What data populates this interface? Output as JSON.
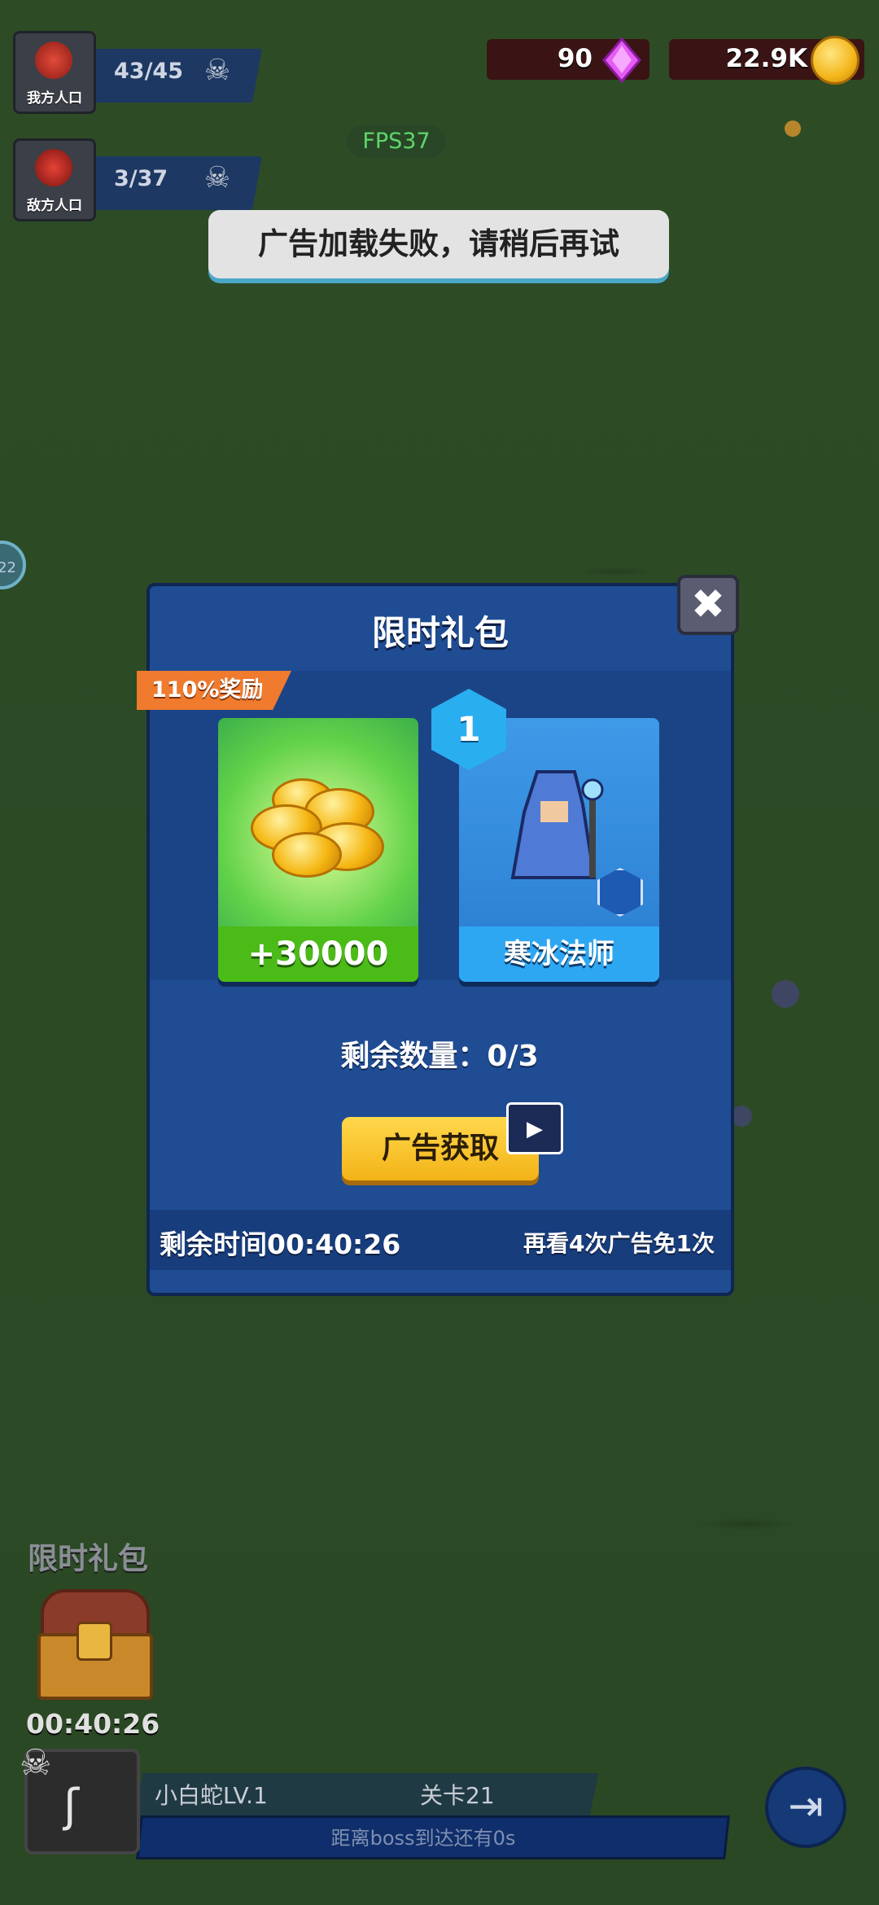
{
  "hud": {
    "ally_pop": {
      "label": "我方人口",
      "count": "43/45"
    },
    "enemy_pop": {
      "label": "敌方人口",
      "count": "3/37"
    },
    "gems": "90",
    "gold": "22.9K",
    "fps": "FPS37",
    "side_badge": "22"
  },
  "toast": "广告加载失败，请稍后再试",
  "modal": {
    "title": "限时礼包",
    "bonus_ribbon": "110%奖励",
    "hero_level": "1",
    "rewards": [
      {
        "label": "+30000",
        "icon": "gold-coins-icon"
      },
      {
        "label": "寒冰法师",
        "icon": "frost-mage-icon"
      }
    ],
    "remaining": "剩余数量：0/3",
    "ad_button": "广告获取",
    "time_left": "剩余时间00:40:26",
    "ad_hint": "再看4次广告免1次",
    "close_icon": "close-icon"
  },
  "chest": {
    "label": "限时礼包",
    "timer": "00:40:26"
  },
  "bottom": {
    "snake_name": "小白蛇LV.1",
    "level": "关卡21",
    "boss_text": "距离boss到达还有0s"
  },
  "colors": {
    "panel": "#1f4c93",
    "accent_gold": "#f3b317",
    "ribbon": "#f07a2e"
  }
}
